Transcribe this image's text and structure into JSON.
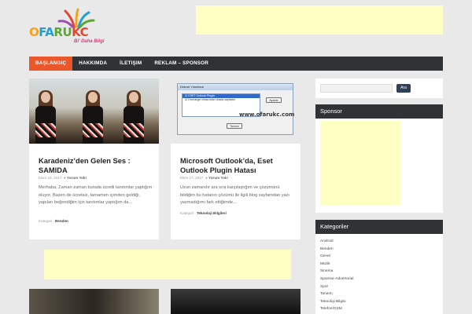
{
  "site": {
    "logo_word": [
      "O",
      "FA",
      "RU",
      "KC"
    ],
    "tagline": "Bi' Daha Bilgi"
  },
  "nav": {
    "items": [
      {
        "label": "Başlangıç",
        "active": true
      },
      {
        "label": "Hakkımda",
        "active": false
      },
      {
        "label": "İletişim",
        "active": false
      },
      {
        "label": "Reklam – Sponsor",
        "active": false
      }
    ]
  },
  "posts": [
    {
      "title": "Karadeniz’den Gelen Ses : SAMIDA",
      "date": "Ekim 23, 2017",
      "comments": "Yorum Yok!",
      "excerpt": "Merhaba, Zaman zaman burada ücretli tanıtımlar yaptığım oluyor. Bazen de ücretsiz, tamamen içimden geldiği, yapıları beğendiğim için tanıtımlar yaptığım da...",
      "category_label": "Kategori :",
      "category": "Benden"
    },
    {
      "title": "Microsoft Outlook’da, Eset Outlook Plugin Hatası",
      "date": "Ekim 17, 2017",
      "comments": "Yorum Yok!",
      "excerpt": "Uzun zamandır ara sıra karşılaştığım ve çözümünü bildiğim bu hatanın çözümü ile ilgili blog sayfamdan yazı yazmadığımı fark ettiğimde...",
      "category_label": "Kategori :",
      "category": "Teknoloji Bilgileri",
      "thumb": {
        "dialog_title": "Eklenti Yöneticisi",
        "list_items": [
          "ESET Outlook Plugin",
          "Exchange cihazından dosda sayfaları"
        ],
        "btn_settings": "Ayarlar",
        "btn_ok": "Tamam",
        "watermark": "www.ofarukc.com"
      }
    }
  ],
  "sidebar": {
    "search_button": "Ara",
    "sponsor_title": "Sponsor",
    "categories_title": "Kategoriler",
    "categories": [
      "Android",
      "Benden",
      "Genel",
      "Müzik",
      "Sinema",
      "Sponsor-Advertorial",
      "Spor",
      "Tanıtım",
      "Teknoloji Bilgisi",
      "Telefon/GSM"
    ]
  }
}
